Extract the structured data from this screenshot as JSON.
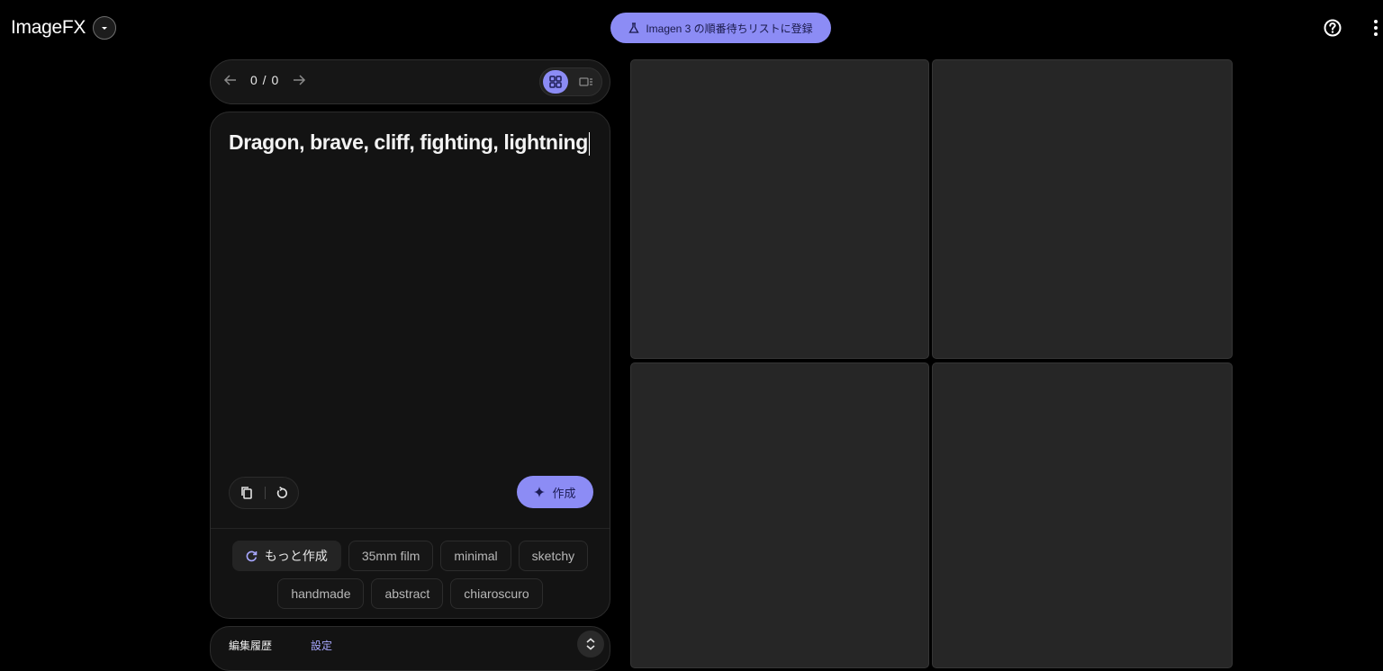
{
  "header": {
    "app_name": "ImageFX",
    "waitlist_label": "Imagen 3 の順番待ちリストに登録"
  },
  "nav": {
    "counter": "0 / 0"
  },
  "prompt": {
    "text": "Dragon, brave, cliff, fighting, lightning",
    "create_label": "作成"
  },
  "chips": {
    "more_label": "もっと作成",
    "styles": [
      "35mm film",
      "minimal",
      "sketchy",
      "handmade",
      "abstract",
      "chiaroscuro"
    ]
  },
  "history": {
    "label": "編集履歴",
    "settings_label": "設定"
  },
  "colors": {
    "accent": "#8c8cf5",
    "background": "#000000",
    "tile": "#262626"
  },
  "icons": [
    "chevron-down-icon",
    "flask-icon",
    "help-icon",
    "more-vert-icon",
    "arrow-left-icon",
    "arrow-right-icon",
    "grid-view-icon",
    "single-view-icon",
    "copy-icon",
    "reset-icon",
    "sparkle-icon",
    "refresh-icon",
    "unfold-icon"
  ]
}
